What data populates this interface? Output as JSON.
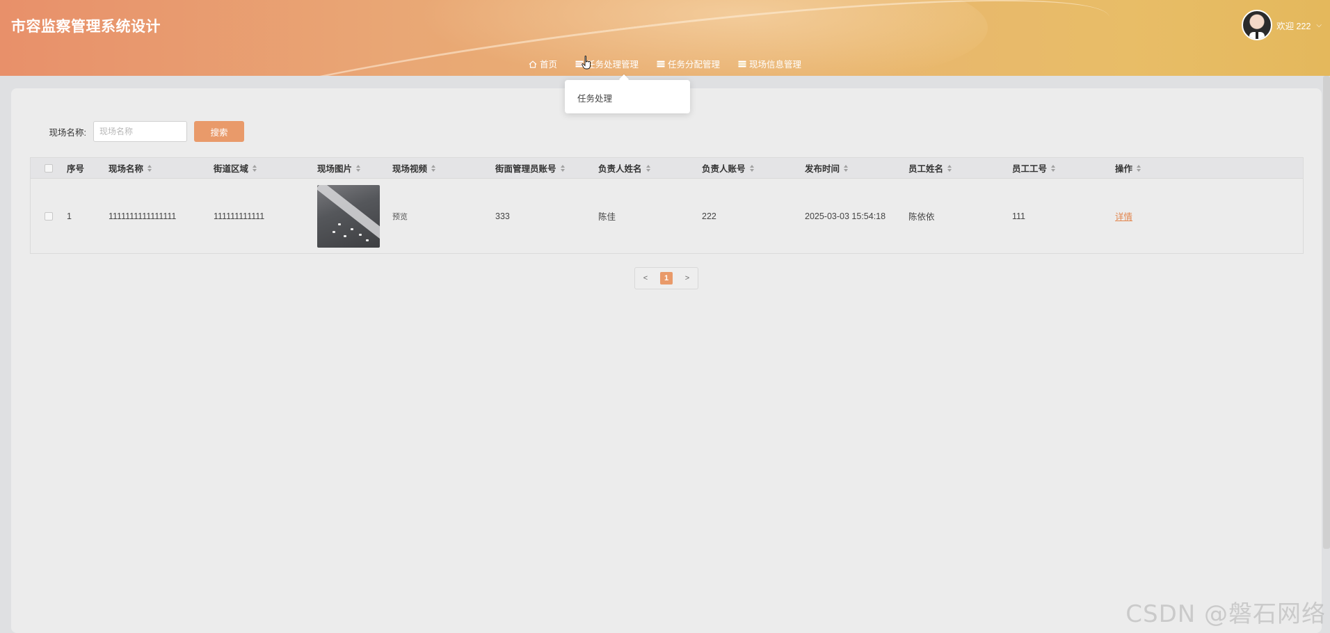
{
  "header": {
    "title": "市容监察管理系统设计",
    "nav": [
      {
        "label": "首页",
        "icon": "home-icon"
      },
      {
        "label": "任务处理管理",
        "icon": "list-icon"
      },
      {
        "label": "任务分配管理",
        "icon": "list-icon"
      },
      {
        "label": "现场信息管理",
        "icon": "list-icon"
      }
    ],
    "user": {
      "greeting": "欢迎 222",
      "dropdown_icon": "chevron-down-icon"
    }
  },
  "dropdown": {
    "items": [
      {
        "label": "任务处理"
      }
    ]
  },
  "search": {
    "label": "现场名称:",
    "placeholder": "现场名称",
    "value": "",
    "button_label": "搜索"
  },
  "table": {
    "columns": [
      "序号",
      "现场名称",
      "街道区域",
      "现场图片",
      "现场视频",
      "街面管理员账号",
      "负责人姓名",
      "负责人账号",
      "发布时间",
      "员工姓名",
      "员工工号",
      "操作"
    ],
    "rows": [
      {
        "index": "1",
        "site_name": "1111111111111111",
        "street_area": "111111111111",
        "image": "scene-photo",
        "video_label": "预览",
        "street_admin_account": "333",
        "leader_name": "陈佳",
        "leader_account": "222",
        "publish_time": "2025-03-03 15:54:18",
        "employee_name": "陈依依",
        "employee_no": "111",
        "action_label": "详情"
      }
    ]
  },
  "pagination": {
    "prev": "<",
    "current": "1",
    "next": ">"
  },
  "watermark": "CSDN @磐石网络",
  "colors": {
    "accent": "#e99a6a",
    "link": "#e2864e",
    "header_start": "#e8906a",
    "header_end": "#e4b85c"
  }
}
